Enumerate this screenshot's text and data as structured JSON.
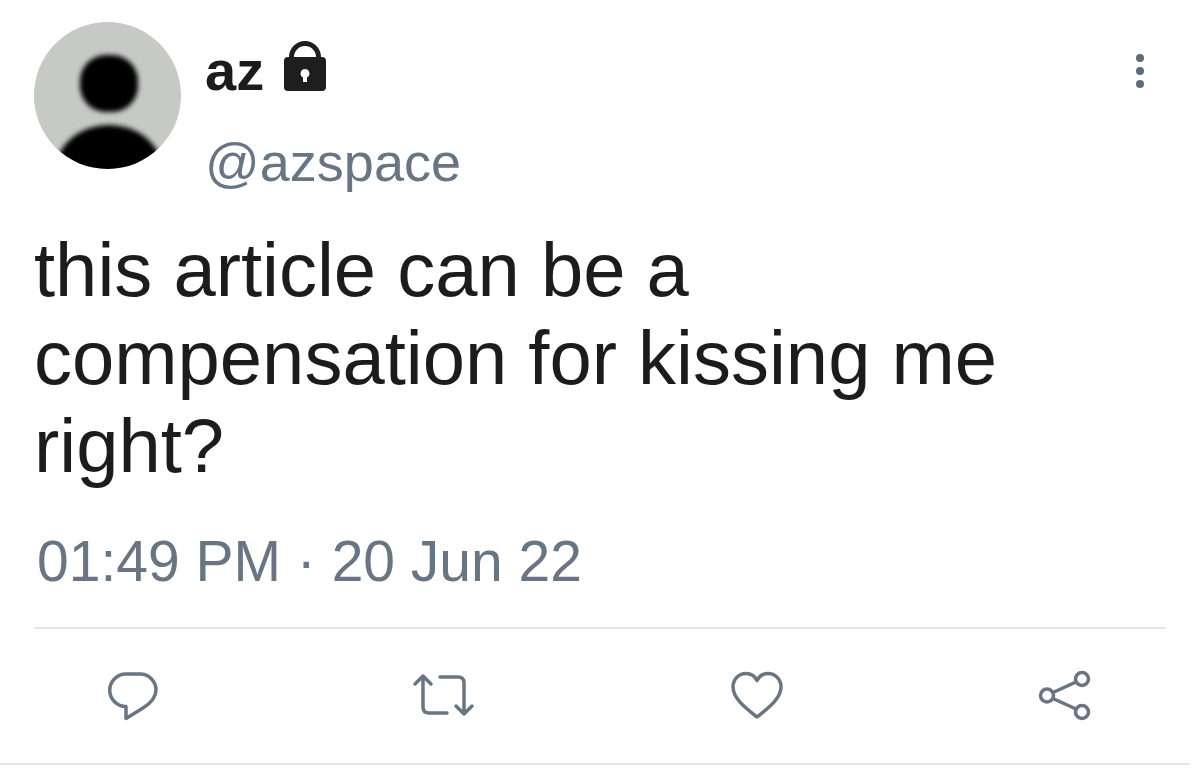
{
  "author": {
    "name": "az",
    "protected": true,
    "handle": "@azspace"
  },
  "tweet": {
    "text": "this article can be a compensation for kissing me right?",
    "timestamp": "01:49 PM · 20 Jun 22"
  },
  "actions": [
    {
      "kind": "reply"
    },
    {
      "kind": "retweet"
    },
    {
      "kind": "like"
    },
    {
      "kind": "share"
    }
  ]
}
